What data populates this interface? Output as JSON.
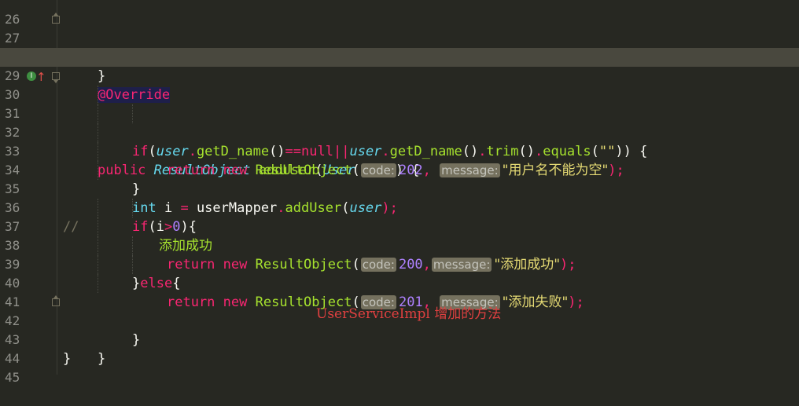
{
  "editor": {
    "current_line": "29",
    "lines": [
      {
        "num": "26"
      },
      {
        "num": "27",
        "text": "}"
      },
      {
        "num": "28"
      },
      {
        "num": "29",
        "ann": "@Override"
      },
      {
        "num": "30",
        "kw": "public",
        "type": "ResultObject",
        "fn": "addUser",
        "open": "(",
        "ptype": "User",
        "pname": "user",
        "close": ") {"
      },
      {
        "num": "31",
        "kw_if": "if",
        "p1": "(",
        "var1": "user",
        "dot1": ".",
        "call1": "getD_name",
        "p2": "()",
        "eq": "==",
        "null": "null",
        "or": "||",
        "var2": "user",
        "dot2": ".",
        "call2": "getD_name",
        "p3": "()",
        "dot3": ".",
        "call3": "trim",
        "p4": "()",
        "dot4": ".",
        "call4": "equals",
        "p5": "(",
        "emptystr": "\"\"",
        "p6": ")) {"
      },
      {
        "num": "32",
        "kw_ret": "return",
        "kw_new": "new",
        "cls": "ResultObject",
        "p1": "(",
        "hint1": "code:",
        "val1": "202",
        "comma": ",",
        "hint2": "message:",
        "str": "\"用户名不能为空\"",
        "end": ");"
      },
      {
        "num": "33",
        "text": "}"
      },
      {
        "num": "34",
        "kw_int": "int",
        "var": "i",
        "eq": " = ",
        "obj": "userMapper",
        "dot": ".",
        "call": "addUser",
        "p1": "(",
        "arg": "user",
        "end": ");"
      },
      {
        "num": "35",
        "kw_if": "if",
        "p1": "(i",
        "gt": ">",
        "zero": "0",
        "p2": "){"
      },
      {
        "num": "36",
        "comment": "//",
        "comment_text": "添加成功"
      },
      {
        "num": "37",
        "kw_ret": "return",
        "kw_new": "new",
        "cls": "ResultObject",
        "p1": "(",
        "hint1": "code:",
        "val1": "200",
        "comma": ",",
        "hint2": "message:",
        "str": "\"添加成功\"",
        "end": ");"
      },
      {
        "num": "38",
        "close": "}",
        "kw_else": "else",
        "open": "{"
      },
      {
        "num": "39",
        "kw_ret": "return",
        "kw_new": "new",
        "cls": "ResultObject",
        "p1": "(",
        "hint1": "code:",
        "val1": "201",
        "comma": ",",
        "hint2": "message:",
        "str": "\"添加失败\"",
        "end": ");"
      },
      {
        "num": "40"
      },
      {
        "num": "41",
        "text": "}"
      },
      {
        "num": "42",
        "text": "}"
      },
      {
        "num": "43",
        "text": "}"
      },
      {
        "num": "44"
      },
      {
        "num": "45"
      }
    ]
  },
  "gutter_icons": {
    "implements": "implements-icon",
    "override": "override-arrow-icon",
    "implements_glyph": "I",
    "override_glyph": "↑"
  },
  "annotation_note": "UserServiceImpl 增加的方法",
  "colors": {
    "background": "#272822",
    "keyword": "#f92672",
    "type": "#66d9ef",
    "function": "#a6e22e",
    "number": "#ae81ff",
    "string": "#e6db74",
    "note": "#e04040"
  }
}
